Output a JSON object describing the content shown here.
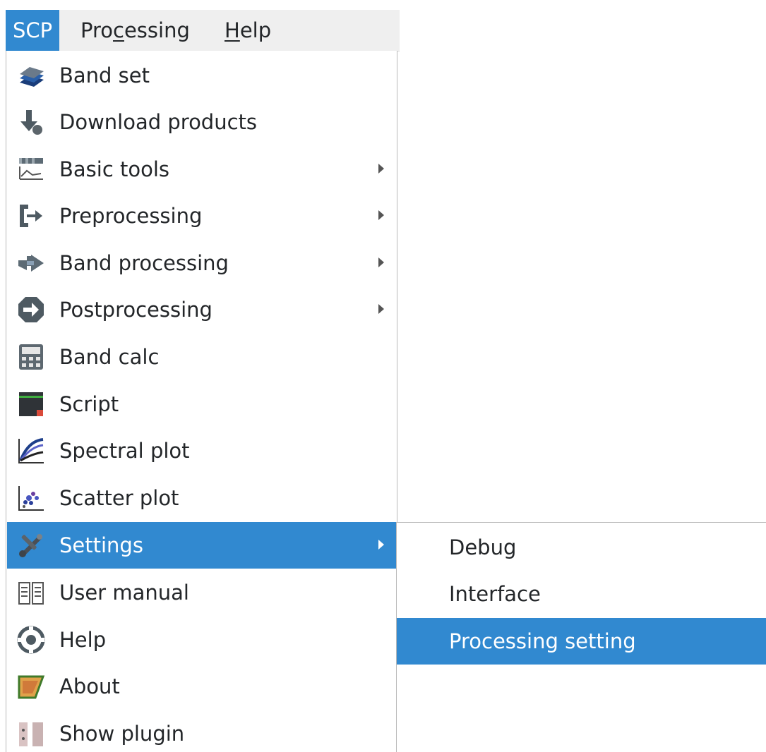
{
  "menubar": {
    "items": [
      {
        "label": "SCP"
      },
      {
        "label_pre": "Pro",
        "label_u": "c",
        "label_post": "essing"
      },
      {
        "label_pre": "",
        "label_u": "H",
        "label_post": "elp"
      }
    ]
  },
  "scp_menu": {
    "items": [
      {
        "label": "Band set",
        "icon": "band-set-icon"
      },
      {
        "label": "Download products",
        "icon": "download-icon"
      },
      {
        "label": "Basic tools",
        "icon": "basic-tools-icon",
        "submenu": true
      },
      {
        "label": "Preprocessing",
        "icon": "preprocessing-icon",
        "submenu": true
      },
      {
        "label": "Band processing",
        "icon": "band-processing-icon",
        "submenu": true
      },
      {
        "label": "Postprocessing",
        "icon": "postprocessing-icon",
        "submenu": true
      },
      {
        "label": "Band calc",
        "icon": "calculator-icon"
      },
      {
        "label": "Script",
        "icon": "script-icon"
      },
      {
        "label": "Spectral plot",
        "icon": "spectral-plot-icon"
      },
      {
        "label": "Scatter plot",
        "icon": "scatter-plot-icon"
      },
      {
        "label": "Settings",
        "icon": "settings-icon",
        "submenu": true,
        "highlighted": true
      },
      {
        "label": "User manual",
        "icon": "user-manual-icon"
      },
      {
        "label": "Help",
        "icon": "help-icon"
      },
      {
        "label": "About",
        "icon": "about-icon"
      },
      {
        "label": "Show plugin",
        "icon": "show-plugin-icon"
      }
    ]
  },
  "settings_submenu": {
    "items": [
      {
        "label": "Debug"
      },
      {
        "label": "Interface"
      },
      {
        "label": "Processing setting",
        "highlighted": true
      }
    ]
  },
  "colors": {
    "highlight": "#3189d0",
    "menubar_bg": "#efefef",
    "text": "#232629"
  }
}
